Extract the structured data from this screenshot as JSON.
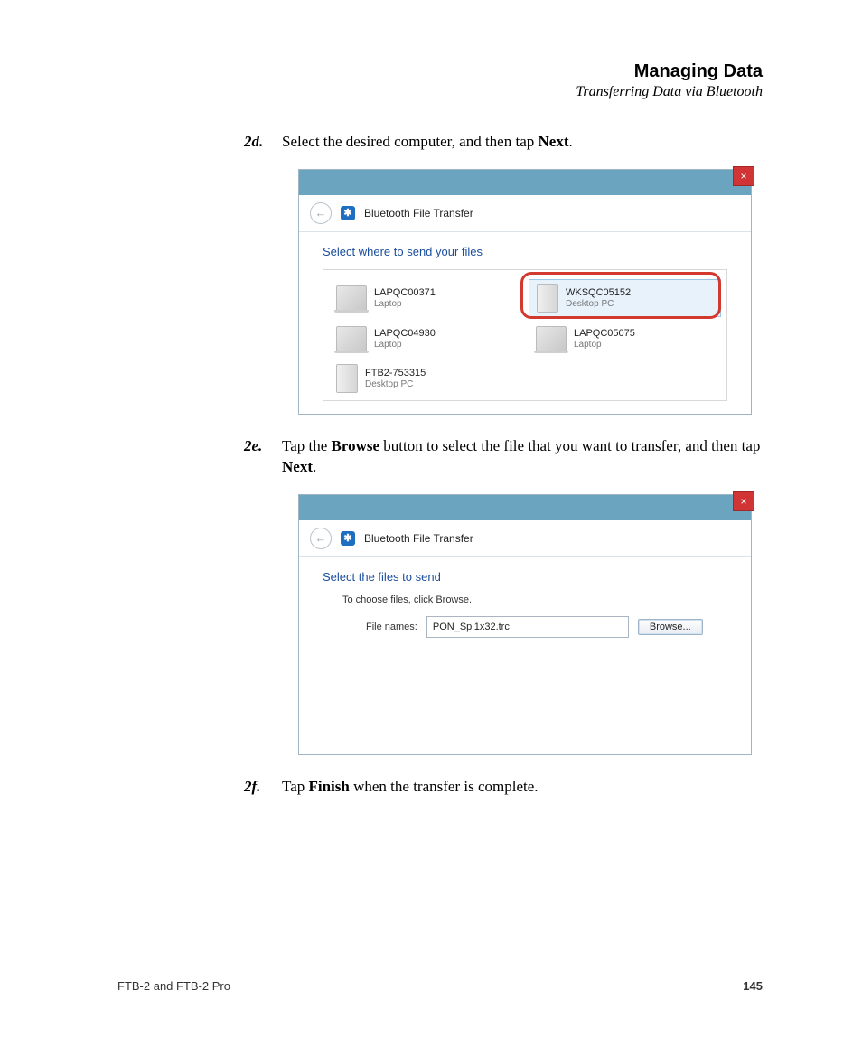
{
  "header": {
    "title": "Managing Data",
    "subtitle": "Transferring Data via Bluetooth"
  },
  "steps": {
    "d": {
      "label": "2d.",
      "pre": "Select the desired computer, and then tap ",
      "bold": "Next",
      "post": "."
    },
    "e": {
      "label": "2e.",
      "pre": "Tap the ",
      "bold1": "Browse",
      "mid": " button to select the file that you want to transfer, and then tap ",
      "bold2": "Next",
      "post": "."
    },
    "f": {
      "label": "2f.",
      "pre": "Tap ",
      "bold": "Finish",
      "post": " when the transfer is complete."
    }
  },
  "dialog1": {
    "title": "Bluetooth File Transfer",
    "prompt": "Select where to send your files",
    "devices": [
      {
        "name": "LAPQC00371",
        "type": "Laptop",
        "kind": "laptop"
      },
      {
        "name": "WKSQC05152",
        "type": "Desktop PC",
        "kind": "desktop",
        "selected": true
      },
      {
        "name": "LAPQC04930",
        "type": "Laptop",
        "kind": "laptop"
      },
      {
        "name": "LAPQC05075",
        "type": "Laptop",
        "kind": "laptop"
      },
      {
        "name": "FTB2-753315",
        "type": "Desktop PC",
        "kind": "desktop"
      }
    ]
  },
  "dialog2": {
    "title": "Bluetooth File Transfer",
    "prompt": "Select the files to send",
    "instruction": "To choose files, click Browse.",
    "file_label": "File names:",
    "file_value": "PON_Spl1x32.trc",
    "browse_label": "Browse..."
  },
  "footer": {
    "product": "FTB-2 and FTB-2 Pro",
    "page": "145"
  },
  "icons": {
    "close": "×",
    "back": "←",
    "bluetooth": "⋮"
  }
}
